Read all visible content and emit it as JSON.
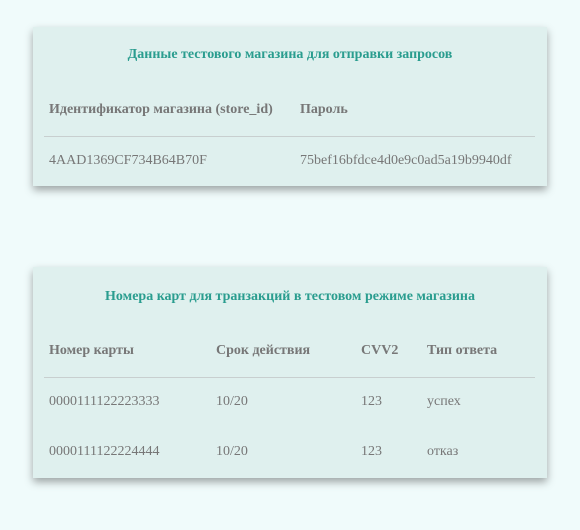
{
  "store_card": {
    "title": "Данные тестового магазина для отправки запросов",
    "headers": [
      "Идентификатор магазина (store_id)",
      "Пароль"
    ],
    "row": [
      "4AAD1369CF734B64B70F",
      "75bef16bfdce4d0e9c0ad5a19b9940df"
    ]
  },
  "cards_card": {
    "title": "Номера карт для транзакций в тестовом режиме магазина",
    "headers": [
      "Номер карты",
      "Срок действия",
      "CVV2",
      "Тип ответа"
    ],
    "rows": [
      [
        "0000111122223333",
        "10/20",
        "123",
        "успех"
      ],
      [
        "0000111122224444",
        "10/20",
        "123",
        "отказ"
      ]
    ]
  }
}
